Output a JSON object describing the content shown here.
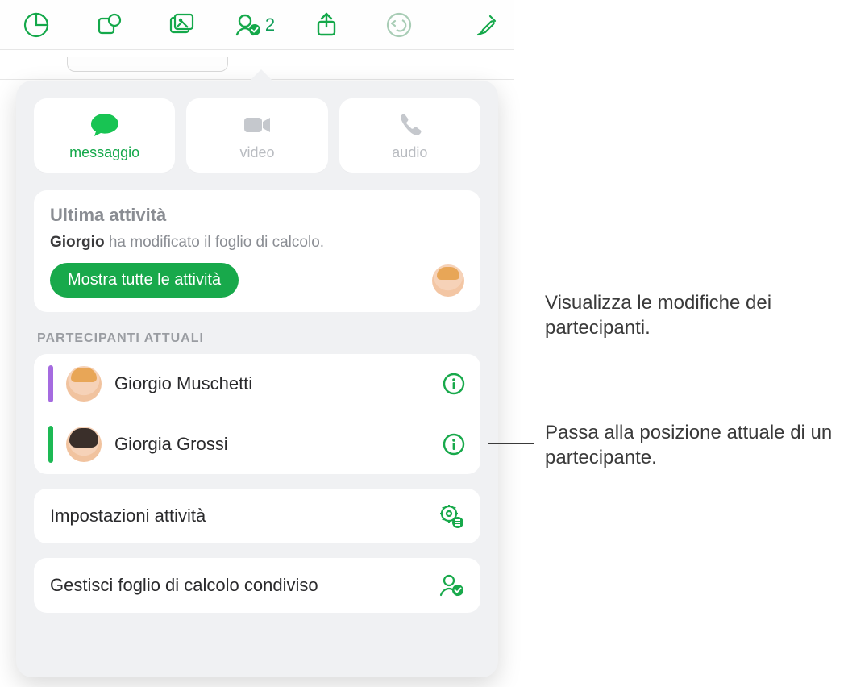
{
  "toolbar": {
    "collab_count": "2"
  },
  "contact": {
    "message": "messaggio",
    "video": "video",
    "audio": "audio"
  },
  "activity": {
    "title": "Ultima attività",
    "actor": "Giorgio",
    "rest": " ha modificato il foglio di calcolo.",
    "show_all": "Mostra tutte le attività"
  },
  "participants": {
    "section": "PARTECIPANTI ATTUALI",
    "items": [
      {
        "name": "Giorgio Muschetti"
      },
      {
        "name": "Giorgia Grossi"
      }
    ]
  },
  "rows": {
    "settings": "Impostazioni attività",
    "manage": "Gestisci foglio di calcolo condiviso"
  },
  "callouts": {
    "a": "Visualizza le modifiche dei partecipanti.",
    "b": "Passa alla posizione attuale di un partecipante."
  }
}
